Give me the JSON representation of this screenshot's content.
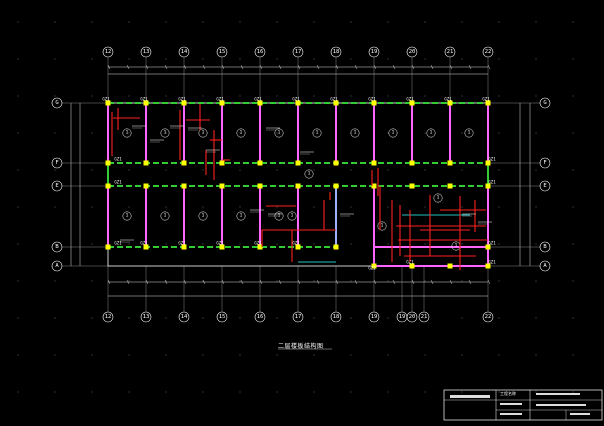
{
  "drawing": {
    "title": "二层楼板结构图",
    "axes_top": [
      "12",
      "13",
      "14",
      "15",
      "16",
      "17",
      "18",
      "19",
      "20",
      "21",
      "22"
    ],
    "axes_bottom": [
      "12",
      "13",
      "14",
      "15",
      "16",
      "17",
      "18",
      "19",
      "19",
      "20",
      "21",
      "22"
    ],
    "axes_side": [
      "G",
      "F",
      "E",
      "B",
      "A"
    ],
    "column_tag": "GZ1",
    "slab_number": "1",
    "colors": {
      "background": "#000000",
      "column": "#ffff00",
      "beam_main": "#ff66ff",
      "beam_green": "#33cc33",
      "rebar_red": "#ff2020",
      "axis_line": "#ffffff",
      "text": "#ffffff",
      "cyan": "#33ffff"
    }
  },
  "title_block": {
    "label": "工程名称"
  }
}
